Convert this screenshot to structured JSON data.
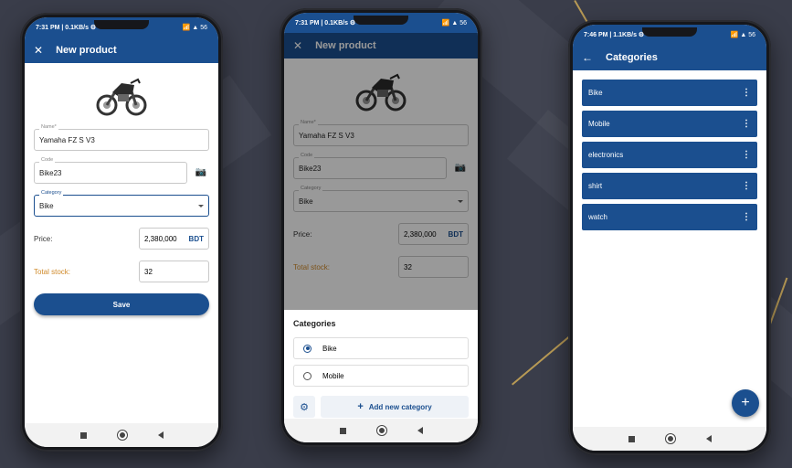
{
  "colors": {
    "primary": "#1b4f8f",
    "orange": "#d08a2a",
    "background": "#3a3d4a"
  },
  "phone1": {
    "status_time": "7:31 PM | 0.1KB/s ⚙",
    "status_icons": "📶 ▲ 56",
    "title": "New product",
    "close_icon": "close-icon",
    "name_label": "Name*",
    "name_value": "Yamaha FZ S V3",
    "code_label": "Code",
    "code_value": "Bike23",
    "category_label": "Category",
    "category_value": "Bike",
    "price_label": "Price:",
    "price_value": "2,380,000",
    "currency": "BDT",
    "stock_label": "Total stock:",
    "stock_value": "32",
    "save_label": "Save"
  },
  "phone2": {
    "status_time": "7:31 PM | 0.1KB/s ⚙",
    "status_icons": "📶 ▲ 56",
    "title": "New product",
    "name_label": "Name*",
    "name_value": "Yamaha FZ S V3",
    "code_label": "Code",
    "code_value": "Bike23",
    "category_label": "Category",
    "category_value": "Bike",
    "price_label": "Price:",
    "price_value": "2,380,000",
    "currency": "BDT",
    "stock_label": "Total stock:",
    "stock_value": "32",
    "sheet_title": "Categories",
    "options": [
      {
        "label": "Bike",
        "selected": true
      },
      {
        "label": "Mobile",
        "selected": false
      }
    ],
    "add_label": "Add new category"
  },
  "phone3": {
    "status_time": "7:46 PM | 1.1KB/s ⚙",
    "status_icons": "📶 ▲ 56",
    "title": "Categories",
    "categories": [
      {
        "label": "Bike"
      },
      {
        "label": "Mobile"
      },
      {
        "label": "electronics"
      },
      {
        "label": "shirt"
      },
      {
        "label": "watch"
      }
    ],
    "fab_label": "+"
  }
}
